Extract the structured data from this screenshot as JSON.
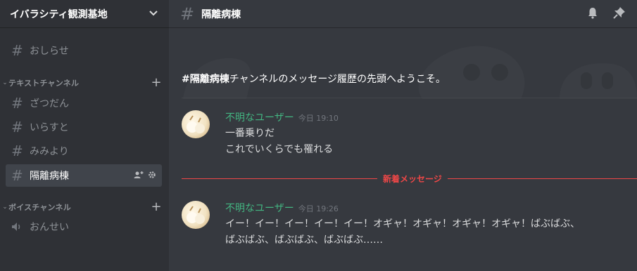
{
  "guild": {
    "name": "イバラシティ観測基地",
    "menu_icon": "chevron-down-icon"
  },
  "sidebar": {
    "top_channel": {
      "label": "おしらせ"
    },
    "text_category": {
      "label": "テキストチャンネル",
      "channels": [
        {
          "label": "ざつだん"
        },
        {
          "label": "いらすと"
        },
        {
          "label": "みみより"
        },
        {
          "label": "隔離病棟",
          "active": true
        }
      ]
    },
    "voice_category": {
      "label": "ボイスチャンネル",
      "channels": [
        {
          "label": "おんせい"
        }
      ]
    }
  },
  "header": {
    "channel_title": "隔離病棟"
  },
  "welcome": {
    "channel": "#隔離病棟",
    "text": "チャンネルのメッセージ履歴の先頭へようこそ。"
  },
  "messages": [
    {
      "author": "不明なユーザー",
      "time": "今日 19:10",
      "lines": [
        "一番乗りだ",
        "これでいくらでも罹れる"
      ]
    },
    {
      "author": "不明なユーザー",
      "time": "今日 19:26",
      "lines": [
        "イー！イー！イー！イー！イー！オギャ！オギャ！オギャ！オギャ！ばぶばぶ、",
        "ばぶばぶ、ばぶばぶ、ばぶばぶ……"
      ]
    }
  ],
  "new_messages_label": "新着メッセージ",
  "colors": {
    "author": "#43b581",
    "new_divider": "#f04747",
    "sidebar": "#2f3136",
    "main": "#36393f"
  }
}
